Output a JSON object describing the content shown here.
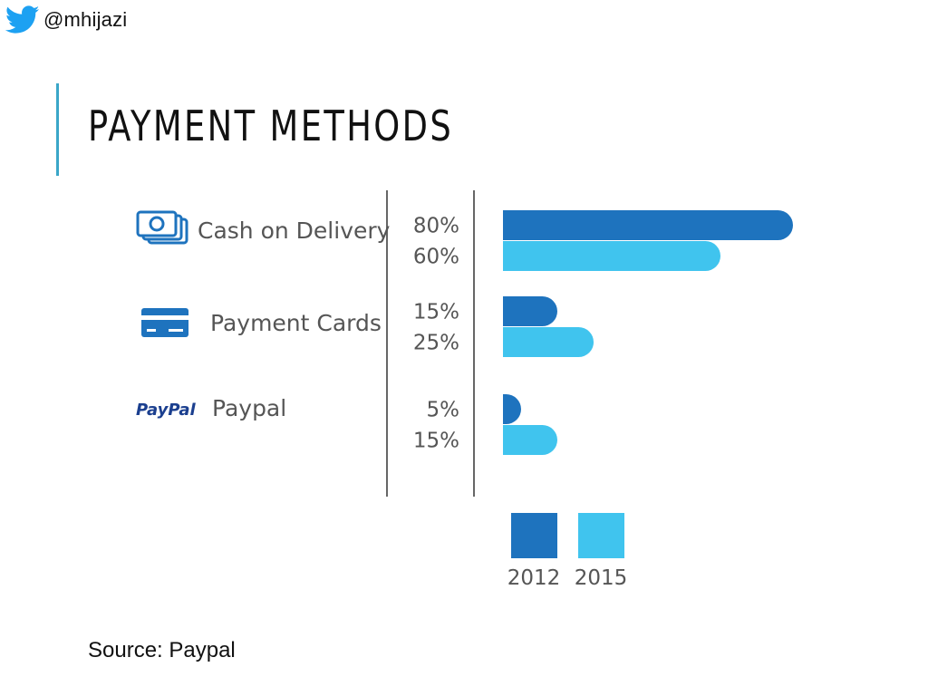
{
  "header": {
    "handle": "@mhijazi",
    "handle_icon": "twitter-bird-icon"
  },
  "slide": {
    "title": "PAYMENT METHODS",
    "source": "Source: Paypal"
  },
  "colors": {
    "accent": "#3aa6c8",
    "series_2012": "#1e73be",
    "series_2015": "#40c4ee",
    "label": "#555555",
    "twitter": "#1da1f2"
  },
  "chart_data": {
    "type": "bar",
    "orientation": "horizontal",
    "title": "",
    "categories": [
      "Cash on Delivery",
      "Payment Cards",
      "Paypal"
    ],
    "category_icons": [
      "cash-icon",
      "credit-card-icon",
      "paypal-logo"
    ],
    "category_icon_text": [
      "",
      "",
      "PayPal"
    ],
    "series": [
      {
        "name": "2012",
        "values": [
          80,
          15,
          5
        ],
        "labels": [
          "80%",
          "15%",
          "5%"
        ]
      },
      {
        "name": "2015",
        "values": [
          60,
          25,
          15
        ],
        "labels": [
          "60%",
          "25%",
          "15%"
        ]
      }
    ],
    "unit": "%",
    "xlim": [
      0,
      100
    ],
    "grid": false,
    "legend": "bottom"
  }
}
